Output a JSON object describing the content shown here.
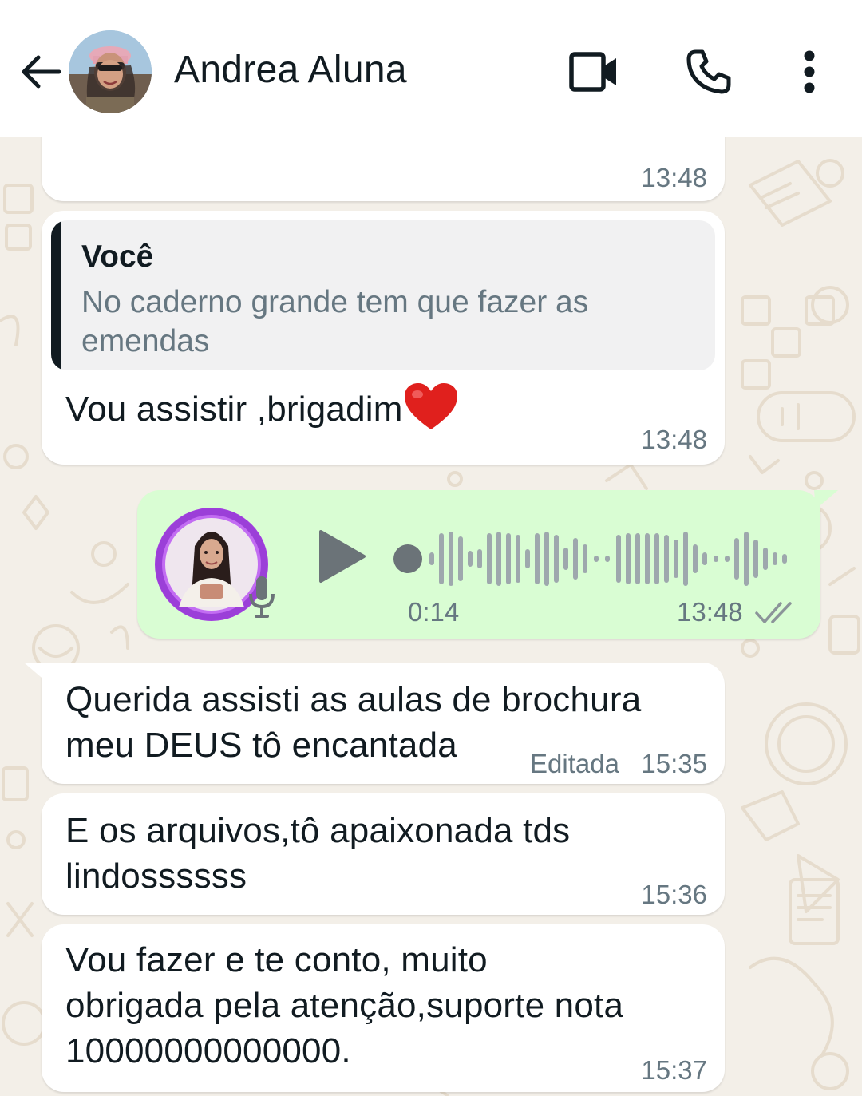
{
  "header": {
    "contact_name": "Andrea Aluna"
  },
  "messages": {
    "m0": {
      "time": "13:48"
    },
    "m1": {
      "quote_author": "Você",
      "quote_text": "No caderno grande tem que fazer as emendas",
      "text": "Vou assistir ,brigadim",
      "emoji": "❤️",
      "time": "13:48"
    },
    "m2": {
      "duration": "0:14",
      "time": "13:48",
      "status": "read"
    },
    "m3": {
      "text_line1": "Querida assisti as aulas de brochura",
      "text_line2": "meu DEUS tô encantada",
      "edited_label": "Editada",
      "time": "15:35"
    },
    "m4": {
      "text_line1": "E os arquivos,tô apaixonada tds",
      "text_line2": "lindossssss",
      "time": "15:36"
    },
    "m5": {
      "text_line1": "Vou fazer e te conto, muito",
      "text_line2": "obrigada pela atenção,suporte nota",
      "text_line3": "10000000000000.",
      "time": "15:37"
    }
  },
  "colors": {
    "incoming_bubble": "#ffffff",
    "outgoing_bubble": "#d9fdd3",
    "chat_background": "#f3efe8",
    "text": "#111b21",
    "meta_text": "#667781"
  },
  "icons": [
    "back-arrow-icon",
    "video-call-icon",
    "phone-icon",
    "more-options-icon",
    "play-icon",
    "microphone-icon",
    "double-check-icon",
    "heart-emoji"
  ]
}
